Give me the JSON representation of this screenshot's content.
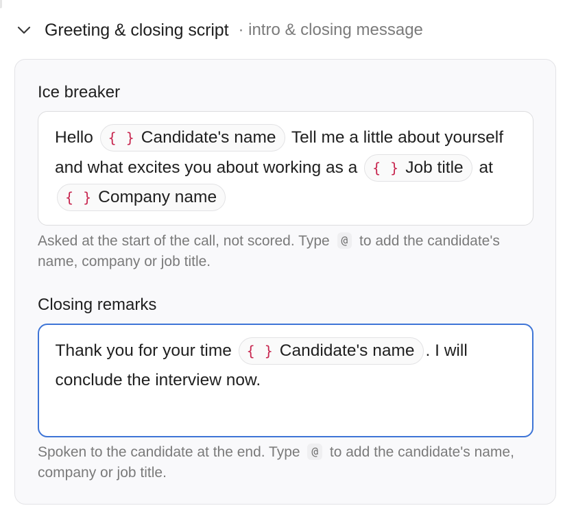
{
  "section": {
    "title": "Greeting & closing script",
    "subtitle": "· intro & closing message",
    "collapse_icon": "chevron-down-icon"
  },
  "ice_breaker": {
    "label": "Ice breaker",
    "segments": {
      "s1": "Hello",
      "chip1": "Candidate's name",
      "s2": "Tell me a little about yourself and what excites you about working as a",
      "chip2": "Job title",
      "s3": "at",
      "chip3": "Company name"
    },
    "hint": {
      "before": "Asked at the start of the call, not scored. Type",
      "key": "@",
      "after": "to add the candidate's name, company or job title."
    }
  },
  "closing_remarks": {
    "label": "Closing remarks",
    "segments": {
      "s1": "Thank you for your time",
      "chip1": "Candidate's name",
      "s2": ". I will conclude the interview now."
    },
    "hint": {
      "before": "Spoken to the candidate at the end. Type",
      "key": "@",
      "after": "to add the candidate's name, company or job title."
    }
  },
  "variable_chip_icon": "{ }",
  "colors": {
    "chip_icon": "#c7254e",
    "focus_border": "#3d74d6",
    "panel_bg": "#f9f9fb"
  }
}
